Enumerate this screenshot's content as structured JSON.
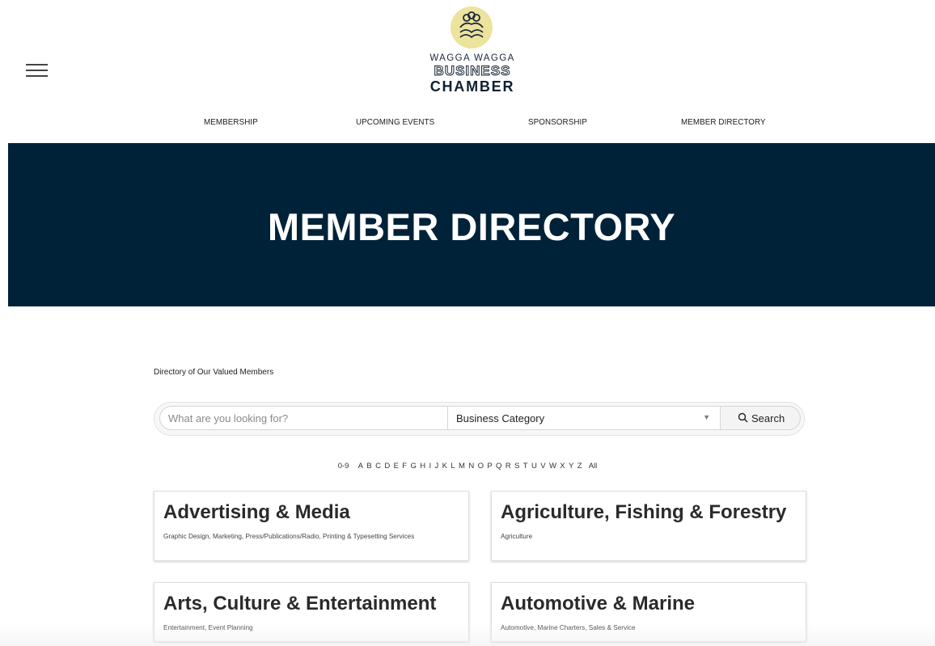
{
  "header": {
    "logo": {
      "line1": "WAGGA WAGGA",
      "line2": "BUSINESS",
      "line3": "CHAMBER",
      "mark_color": "#ece39d"
    },
    "menu_icon": "hamburger-menu-icon"
  },
  "nav": {
    "items": [
      {
        "label": "MEMBERSHIP"
      },
      {
        "label": "UPCOMING EVENTS"
      },
      {
        "label": "SPONSORSHIP"
      },
      {
        "label": "MEMBER DIRECTORY"
      }
    ]
  },
  "hero": {
    "title": "MEMBER DIRECTORY",
    "background": "#002238"
  },
  "directory": {
    "intro": "Directory of Our Valued Members",
    "search": {
      "placeholder": "What are you looking for?",
      "value": "",
      "category_selected": "Business Category",
      "button_label": "Search",
      "button_icon": "search-icon"
    },
    "alphabet": [
      "0-9",
      "A",
      "B",
      "C",
      "D",
      "E",
      "F",
      "G",
      "H",
      "I",
      "J",
      "K",
      "L",
      "M",
      "N",
      "O",
      "P",
      "Q",
      "R",
      "S",
      "T",
      "U",
      "V",
      "W",
      "X",
      "Y",
      "Z",
      "All"
    ],
    "categories": [
      {
        "title": "Advertising & Media",
        "subtitle": "Graphic Design, Marketing, Press/Publications/Radio, Printing & Typesetting Services"
      },
      {
        "title": "Agriculture, Fishing & Forestry",
        "subtitle": "Agriculture"
      },
      {
        "title": "Arts, Culture & Entertainment",
        "subtitle": "Entertainment, Event Planning"
      },
      {
        "title": "Automotive & Marine",
        "subtitle": "Automotive, Marine Charters, Sales & Service"
      }
    ]
  }
}
